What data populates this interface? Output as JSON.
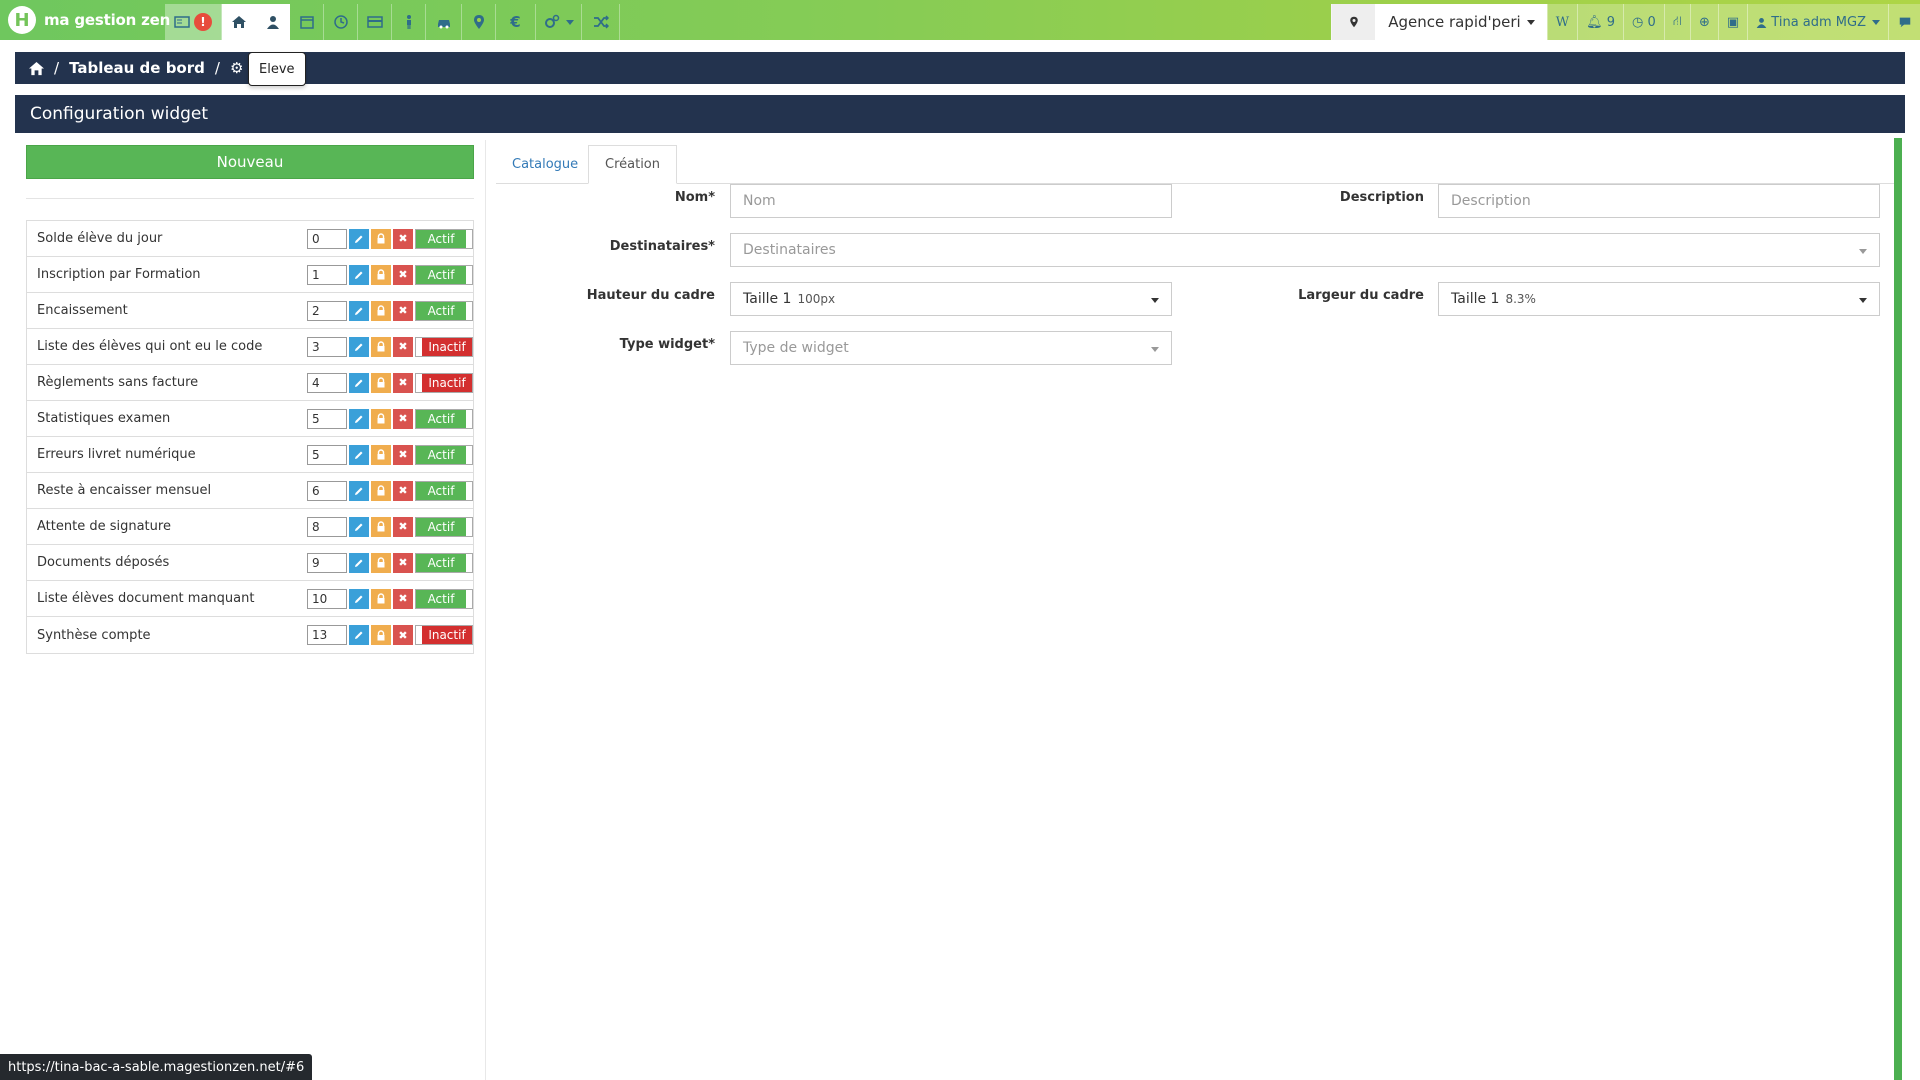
{
  "app": {
    "brand": "ma gestion zen",
    "logo_letter": "H"
  },
  "topnav": {
    "alert_count": "!",
    "tooltip": "Eleve",
    "icons": [
      "card-icon",
      "home-icon",
      "user-icon",
      "calendar-icon",
      "clock-icon",
      "credit-card-icon",
      "person-icon",
      "car-icon",
      "map-marker-icon",
      "euro-icon",
      "gears-icon",
      "shuffle-icon"
    ]
  },
  "rightnav": {
    "agency": "Agence rapid'peri",
    "w": "W",
    "bell_count": "9",
    "clock_count": "0",
    "user": "Tina adm MGZ"
  },
  "breadcrumb": {
    "items": [
      "Tableau de bord"
    ],
    "sep": "/"
  },
  "section": {
    "title": "Configuration widget"
  },
  "left": {
    "new_button": "Nouveau",
    "widgets": [
      {
        "name": "Solde élève du jour",
        "order": "0",
        "status": "Actif",
        "active": true
      },
      {
        "name": "Inscription par Formation",
        "order": "1",
        "status": "Actif",
        "active": true
      },
      {
        "name": "Encaissement",
        "order": "2",
        "status": "Actif",
        "active": true
      },
      {
        "name": "Liste des élèves qui ont eu le code",
        "order": "3",
        "status": "Inactif",
        "active": false
      },
      {
        "name": "Règlements sans facture",
        "order": "4",
        "status": "Inactif",
        "active": false
      },
      {
        "name": "Statistiques examen",
        "order": "5",
        "status": "Actif",
        "active": true
      },
      {
        "name": "Erreurs livret numérique",
        "order": "5",
        "status": "Actif",
        "active": true
      },
      {
        "name": "Reste à encaisser mensuel",
        "order": "6",
        "status": "Actif",
        "active": true
      },
      {
        "name": "Attente de signature",
        "order": "8",
        "status": "Actif",
        "active": true
      },
      {
        "name": "Documents déposés",
        "order": "9",
        "status": "Actif",
        "active": true
      },
      {
        "name": "Liste élèves document manquant",
        "order": "10",
        "status": "Actif",
        "active": true
      },
      {
        "name": "Synthèse compte",
        "order": "13",
        "status": "Inactif",
        "active": false
      }
    ]
  },
  "tabs": {
    "catalogue": "Catalogue",
    "creation": "Création"
  },
  "form": {
    "nom_label": "Nom*",
    "nom_placeholder": "Nom",
    "description_label": "Description",
    "description_placeholder": "Description",
    "destinataires_label": "Destinataires*",
    "destinataires_placeholder": "Destinataires",
    "hauteur_label": "Hauteur du cadre",
    "hauteur_value": "Taille 1",
    "hauteur_detail": "100px",
    "largeur_label": "Largeur du cadre",
    "largeur_value": "Taille 1",
    "largeur_detail": "8.3%",
    "type_label": "Type widget*",
    "type_placeholder": "Type de widget"
  },
  "status_url": "https://tina-bac-a-sable.magestionzen.net/#6",
  "colors": {
    "navy": "#23334e",
    "green": "#58b656",
    "red": "#d32f2f",
    "blue": "#3aa0d9",
    "orange": "#f0ad4e"
  }
}
